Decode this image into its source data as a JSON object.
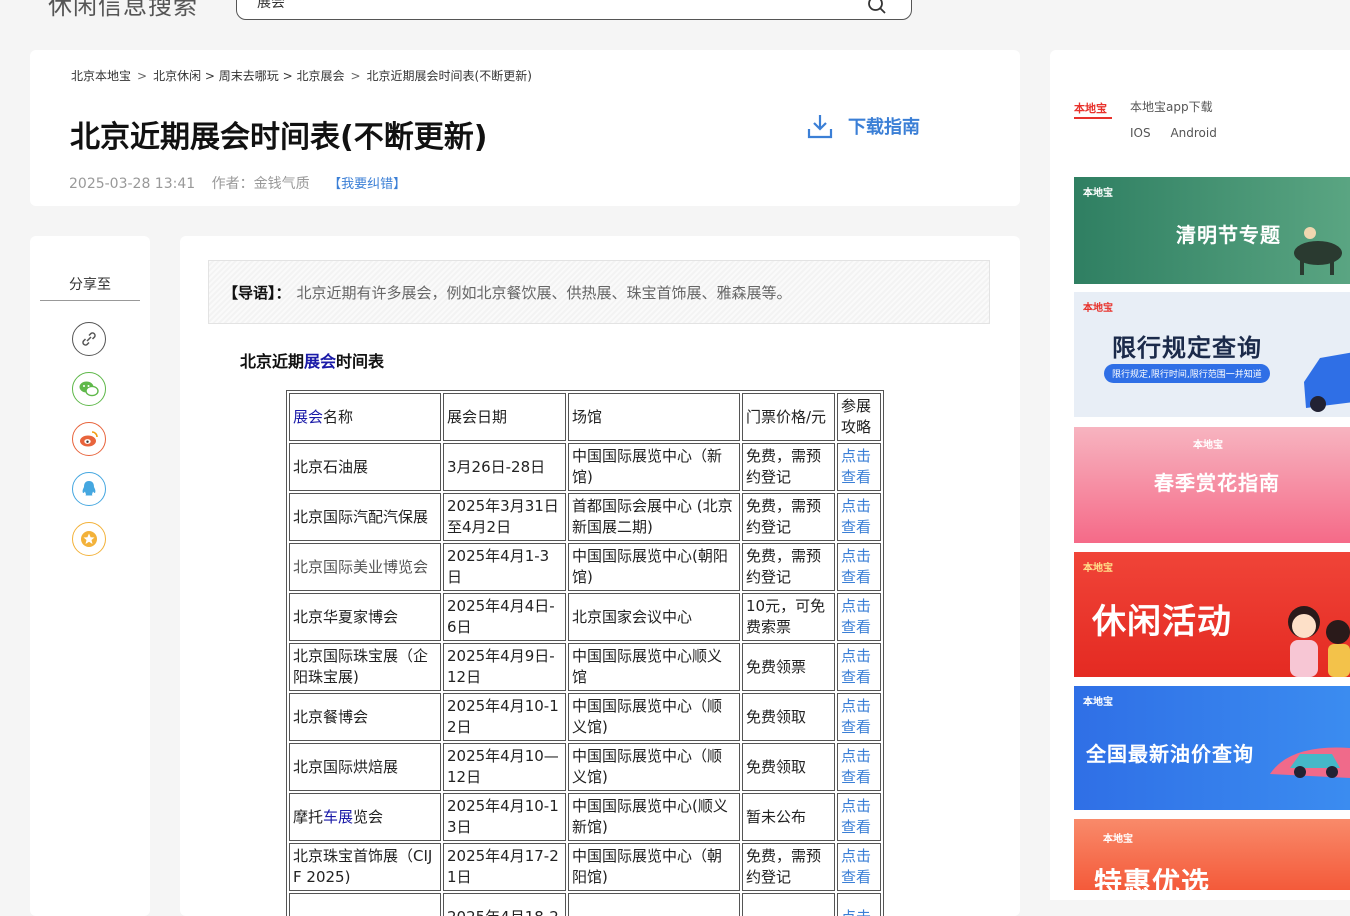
{
  "site": {
    "name": "休闲信息搜索",
    "search_value": "展会"
  },
  "breadcrumb": [
    "北京本地宝",
    "北京休闲 > 周末去哪玩 > 北京展会",
    "北京近期展会时间表(不断更新)"
  ],
  "article": {
    "title": "北京近期展会时间表(不断更新)",
    "date": "2025-03-28 13:41",
    "author": "作者：金钱气质",
    "report_link": "【我要纠错】",
    "download_label": "下载指南",
    "lead_label": "【导语】：",
    "lead_text": "北京近期有许多展会，例如北京餐饮展、供热展、珠宝首饰展、雅森展等。",
    "section_title_pre": "北京近期",
    "section_title_hl": "展会",
    "section_title_post": "时间表"
  },
  "share": {
    "title": "分享至"
  },
  "table": {
    "headers": {
      "name_hl": "展会",
      "name_rest": "名称",
      "date": "展会日期",
      "venue": "场馆",
      "price": "门票价格/元",
      "guide": "参展攻略"
    },
    "rows": [
      {
        "name": "北京石油展",
        "date": "3月26日-28日",
        "venue": "中国国际展览中心（新馆)",
        "price": "免费，需预约登记",
        "guide": "点击查看"
      },
      {
        "name": "北京国际汽配汽保展",
        "date": "2025年3月31日至4月2日",
        "venue": "首都国际会展中心 (北京新国展二期)",
        "price": "免费，需预约登记",
        "guide": "点击查看"
      },
      {
        "name": "北京国际美业博览会",
        "date": "2025年4月1-3日",
        "venue": "中国国际展览中心(朝阳馆)",
        "price": "免费，需预约登记",
        "guide": "点击查看"
      },
      {
        "name": "北京华夏家博会",
        "date": "2025年4月4日-6日",
        "venue": "北京国家会议中心",
        "price": "10元，可免费索票",
        "guide": "点击查看"
      },
      {
        "name": "北京国际珠宝展（企阳珠宝展)",
        "date": "2025年4月9日-12日",
        "venue": "中国国际展览中心顺义馆",
        "price": "免费领票",
        "guide": "点击查看"
      },
      {
        "name": "北京餐博会",
        "date": "2025年4月10-12日",
        "venue": "中国国际展览中心（顺义馆)",
        "price": "免费领取",
        "guide": "点击查看"
      },
      {
        "name": "北京国际烘焙展",
        "date": "2025年4月10—12日",
        "venue": "中国国际展览中心（顺义馆)",
        "price": "免费领取",
        "guide": "点击查看"
      },
      {
        "name_pre": "摩托",
        "name_hl": "车展",
        "name_post": "览会",
        "date": "2025年4月10-13日",
        "venue": "中国国际展览中心(顺义新馆)",
        "price": "暂未公布",
        "guide": "点击查看"
      },
      {
        "name": "北京珠宝首饰展（CIJF 2025)",
        "date": "2025年4月17-21日",
        "venue": "中国国际展览中心（朝阳馆)",
        "price": "免费，需预约登记",
        "guide": "点击查看"
      },
      {
        "name": "",
        "date": "2025年4月18-2",
        "venue": "",
        "price": "",
        "guide": "点击"
      }
    ]
  },
  "sidebar": {
    "app_title": "本地宝app下载",
    "app_logo_text": "本地宝",
    "app_links": [
      "IOS",
      "Android"
    ],
    "banners": [
      {
        "text": "清明节专题",
        "color": "#3f8f6f"
      },
      {
        "text": "限行规定查询",
        "sub": "限行规定,限行时间,限行范围一并知道",
        "color": "#e7eef6"
      },
      {
        "text": "春季赏花指南",
        "color": "#f7839a"
      },
      {
        "text": "休闲活动",
        "color": "#e8322c"
      },
      {
        "text": "全国最新油价查询",
        "color": "#2f6fe6"
      },
      {
        "text": "特惠优选",
        "color": "#f56a4a"
      }
    ],
    "banner_logo": "本地宝"
  }
}
